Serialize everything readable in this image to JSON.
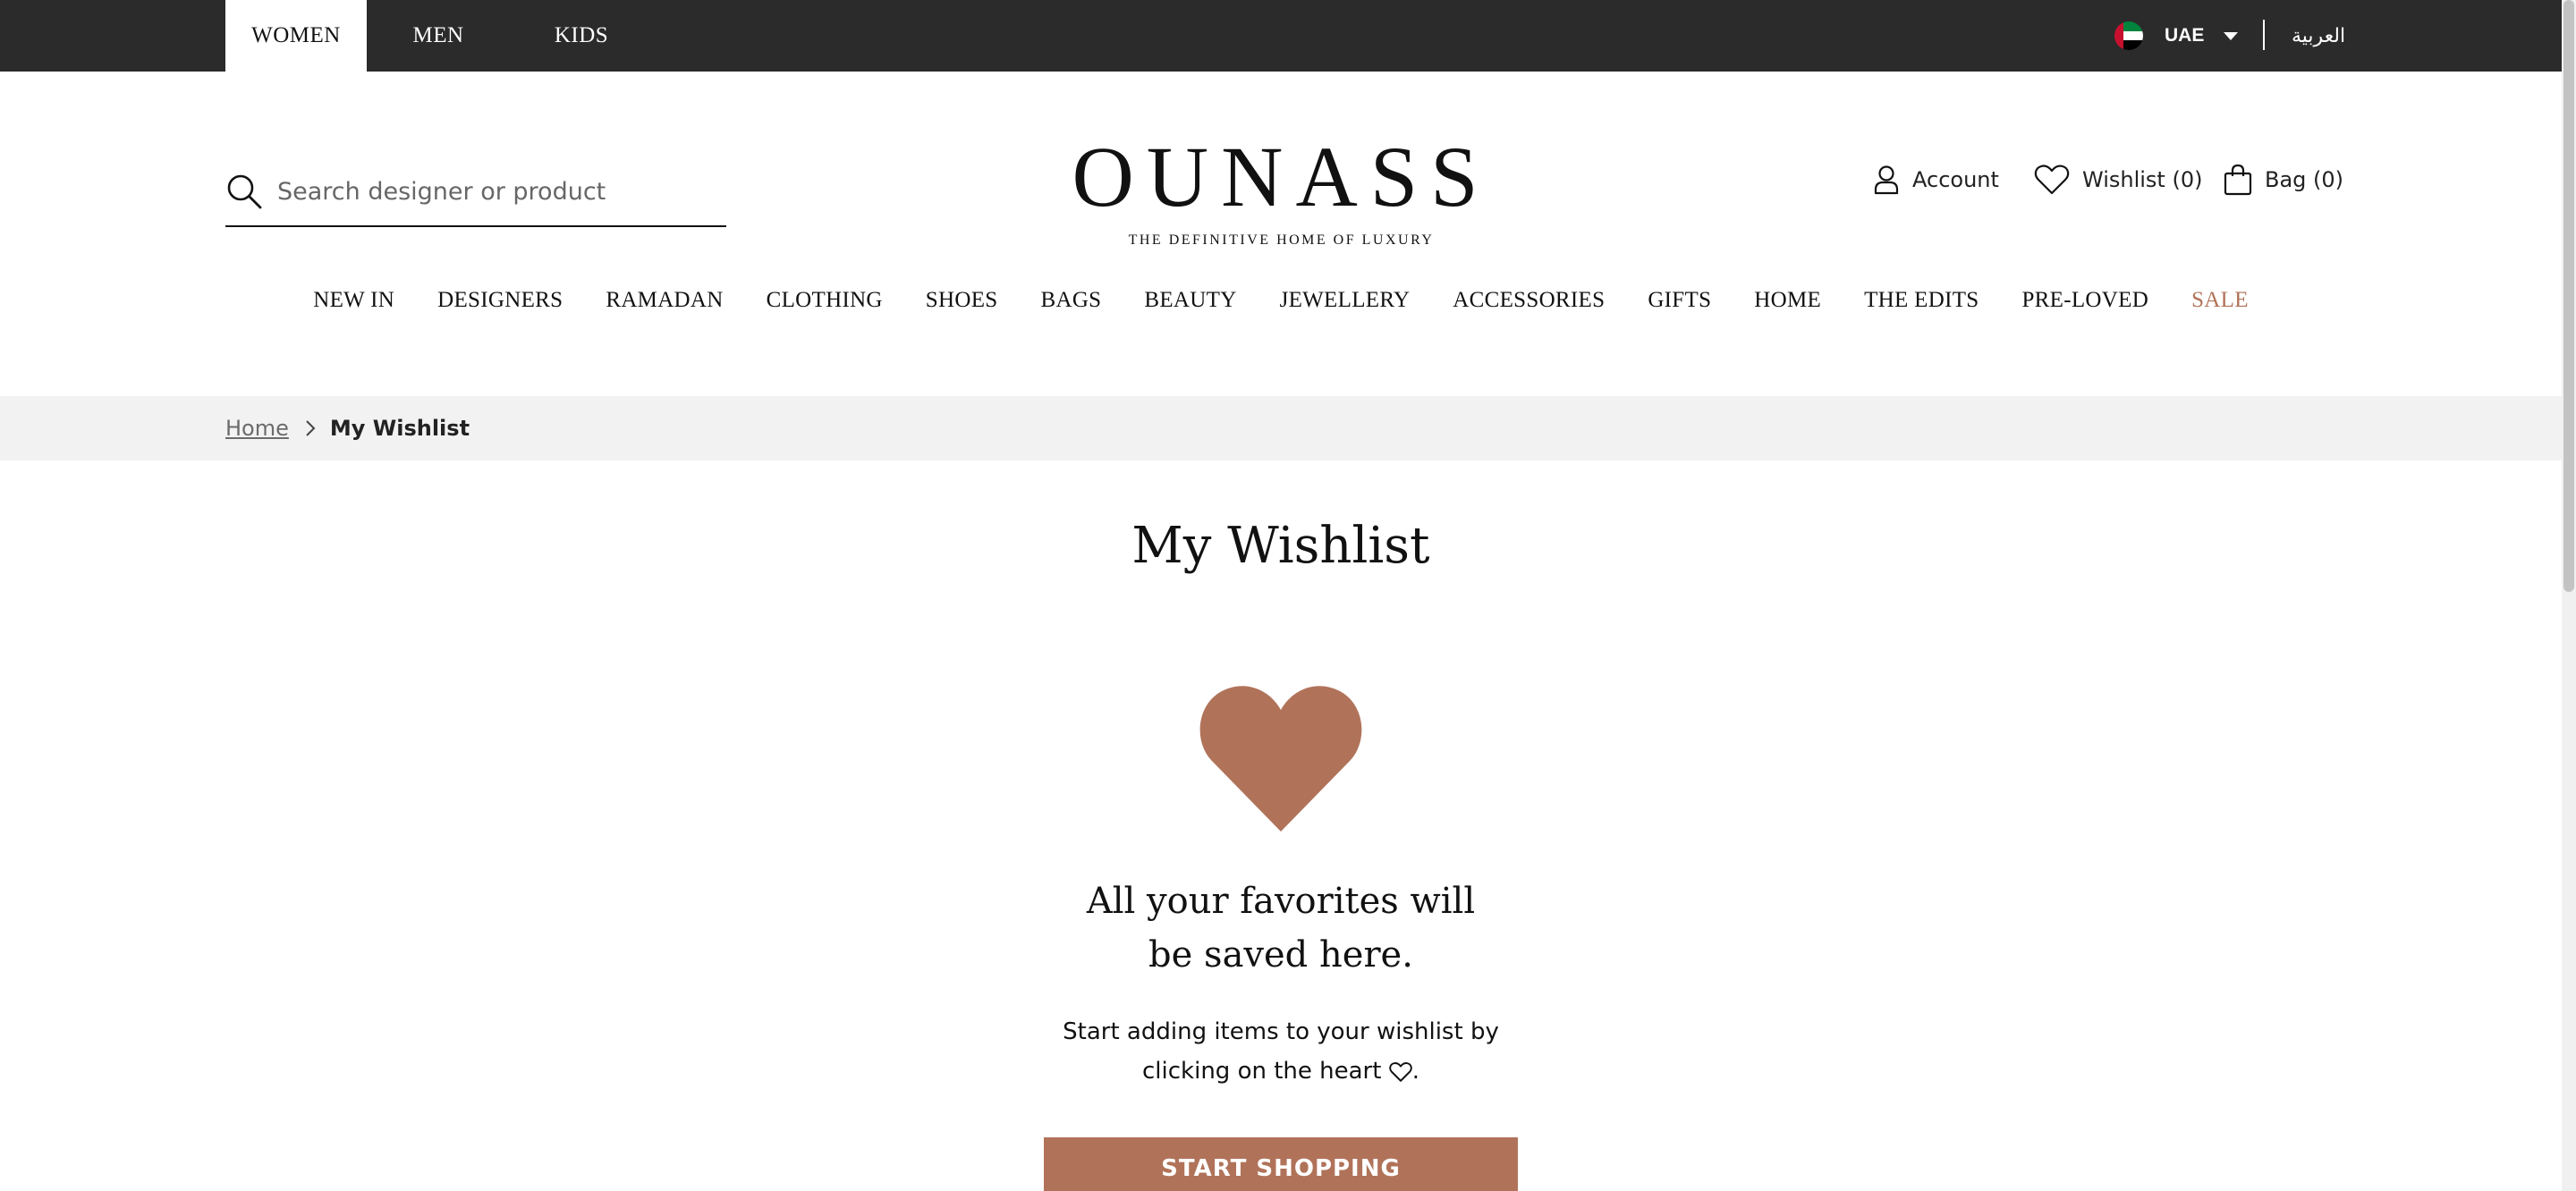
{
  "topbar": {
    "tabs": [
      {
        "label": "WOMEN",
        "active": true
      },
      {
        "label": "MEN",
        "active": false
      },
      {
        "label": "KIDS",
        "active": false
      }
    ],
    "region": "UAE",
    "language": "العربية",
    "bg_color": "#2b2b2b"
  },
  "header": {
    "search_placeholder": "Search designer or product",
    "logo": "OUNASS",
    "tagline": "THE DEFINITIVE HOME OF LUXURY",
    "account_label": "Account",
    "wishlist_label": "Wishlist (0)",
    "bag_label": "Bag (0)"
  },
  "nav": {
    "items": [
      "NEW IN",
      "DESIGNERS",
      "RAMADAN",
      "CLOTHING",
      "SHOES",
      "BAGS",
      "BEAUTY",
      "JEWELLERY",
      "ACCESSORIES",
      "GIFTS",
      "HOME",
      "THE EDITS",
      "PRE-LOVED",
      "SALE"
    ],
    "sale_color": "#b07258"
  },
  "breadcrumb": {
    "home": "Home",
    "current": "My Wishlist"
  },
  "main": {
    "title": "My Wishlist",
    "empty_heading_line1": "All your favorites will",
    "empty_heading_line2": "be saved here.",
    "empty_text_line1": "Start adding items to your wishlist by",
    "empty_text_line2": "clicking on the heart",
    "empty_text_end": ".",
    "cta_label": "START SHOPPING",
    "accent_color": "#b0735a"
  },
  "icons": [
    "search-icon",
    "user-icon",
    "heart-icon",
    "bag-icon",
    "chevron-right-icon",
    "caret-down-icon",
    "uae-flag-icon"
  ]
}
